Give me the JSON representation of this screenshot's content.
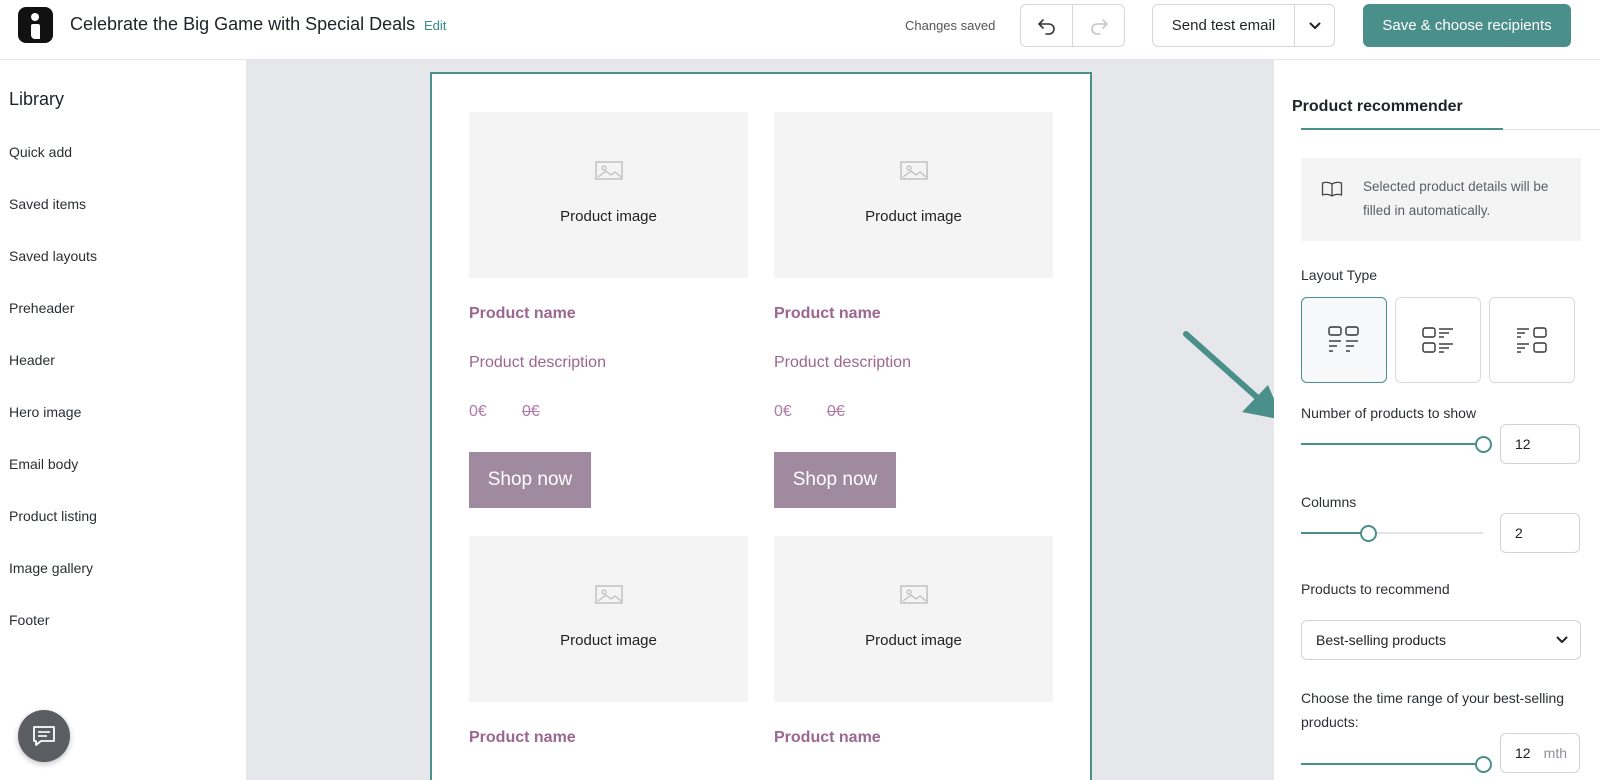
{
  "header": {
    "title": "Celebrate the Big Game with Special Deals",
    "edit_label": "Edit",
    "status": "Changes saved",
    "send_test_label": "Send test email",
    "save_label": "Save & choose recipients",
    "accent_color": "#4b8f8a"
  },
  "library": {
    "title": "Library",
    "items": [
      "Quick add",
      "Saved items",
      "Saved layouts",
      "Preheader",
      "Header",
      "Hero image",
      "Email body",
      "Product listing",
      "Image gallery",
      "Footer"
    ]
  },
  "email": {
    "cards": [
      {
        "image_label": "Product image",
        "name": "Product name",
        "description": "Product description",
        "price": "0€",
        "old_price": "0€",
        "button": "Shop now"
      },
      {
        "image_label": "Product image",
        "name": "Product name",
        "description": "Product description",
        "price": "0€",
        "old_price": "0€",
        "button": "Shop now"
      },
      {
        "image_label": "Product image",
        "name": "Product name"
      },
      {
        "image_label": "Product image",
        "name": "Product name"
      }
    ],
    "text_color": "#9b6690",
    "button_color": "#a08aa0"
  },
  "panel": {
    "tab": "Product recommender",
    "info": "Selected product details will be filled in automatically.",
    "layout_type_label": "Layout Type",
    "layout_options": [
      "grid-layout-icon",
      "list-layout-icon",
      "alternating-layout-icon"
    ],
    "selected_layout": 0,
    "products_count_label": "Number of products to show",
    "products_count": "12",
    "products_count_level": 1.0,
    "columns_label": "Columns",
    "columns": "2",
    "columns_level": 0.37,
    "recommend_label": "Products to recommend",
    "recommend_value": "Best-selling products",
    "time_range_label": "Choose the time range of your best-selling products:",
    "time_range": "12",
    "time_range_unit": "mth",
    "time_range_level": 1.0
  }
}
